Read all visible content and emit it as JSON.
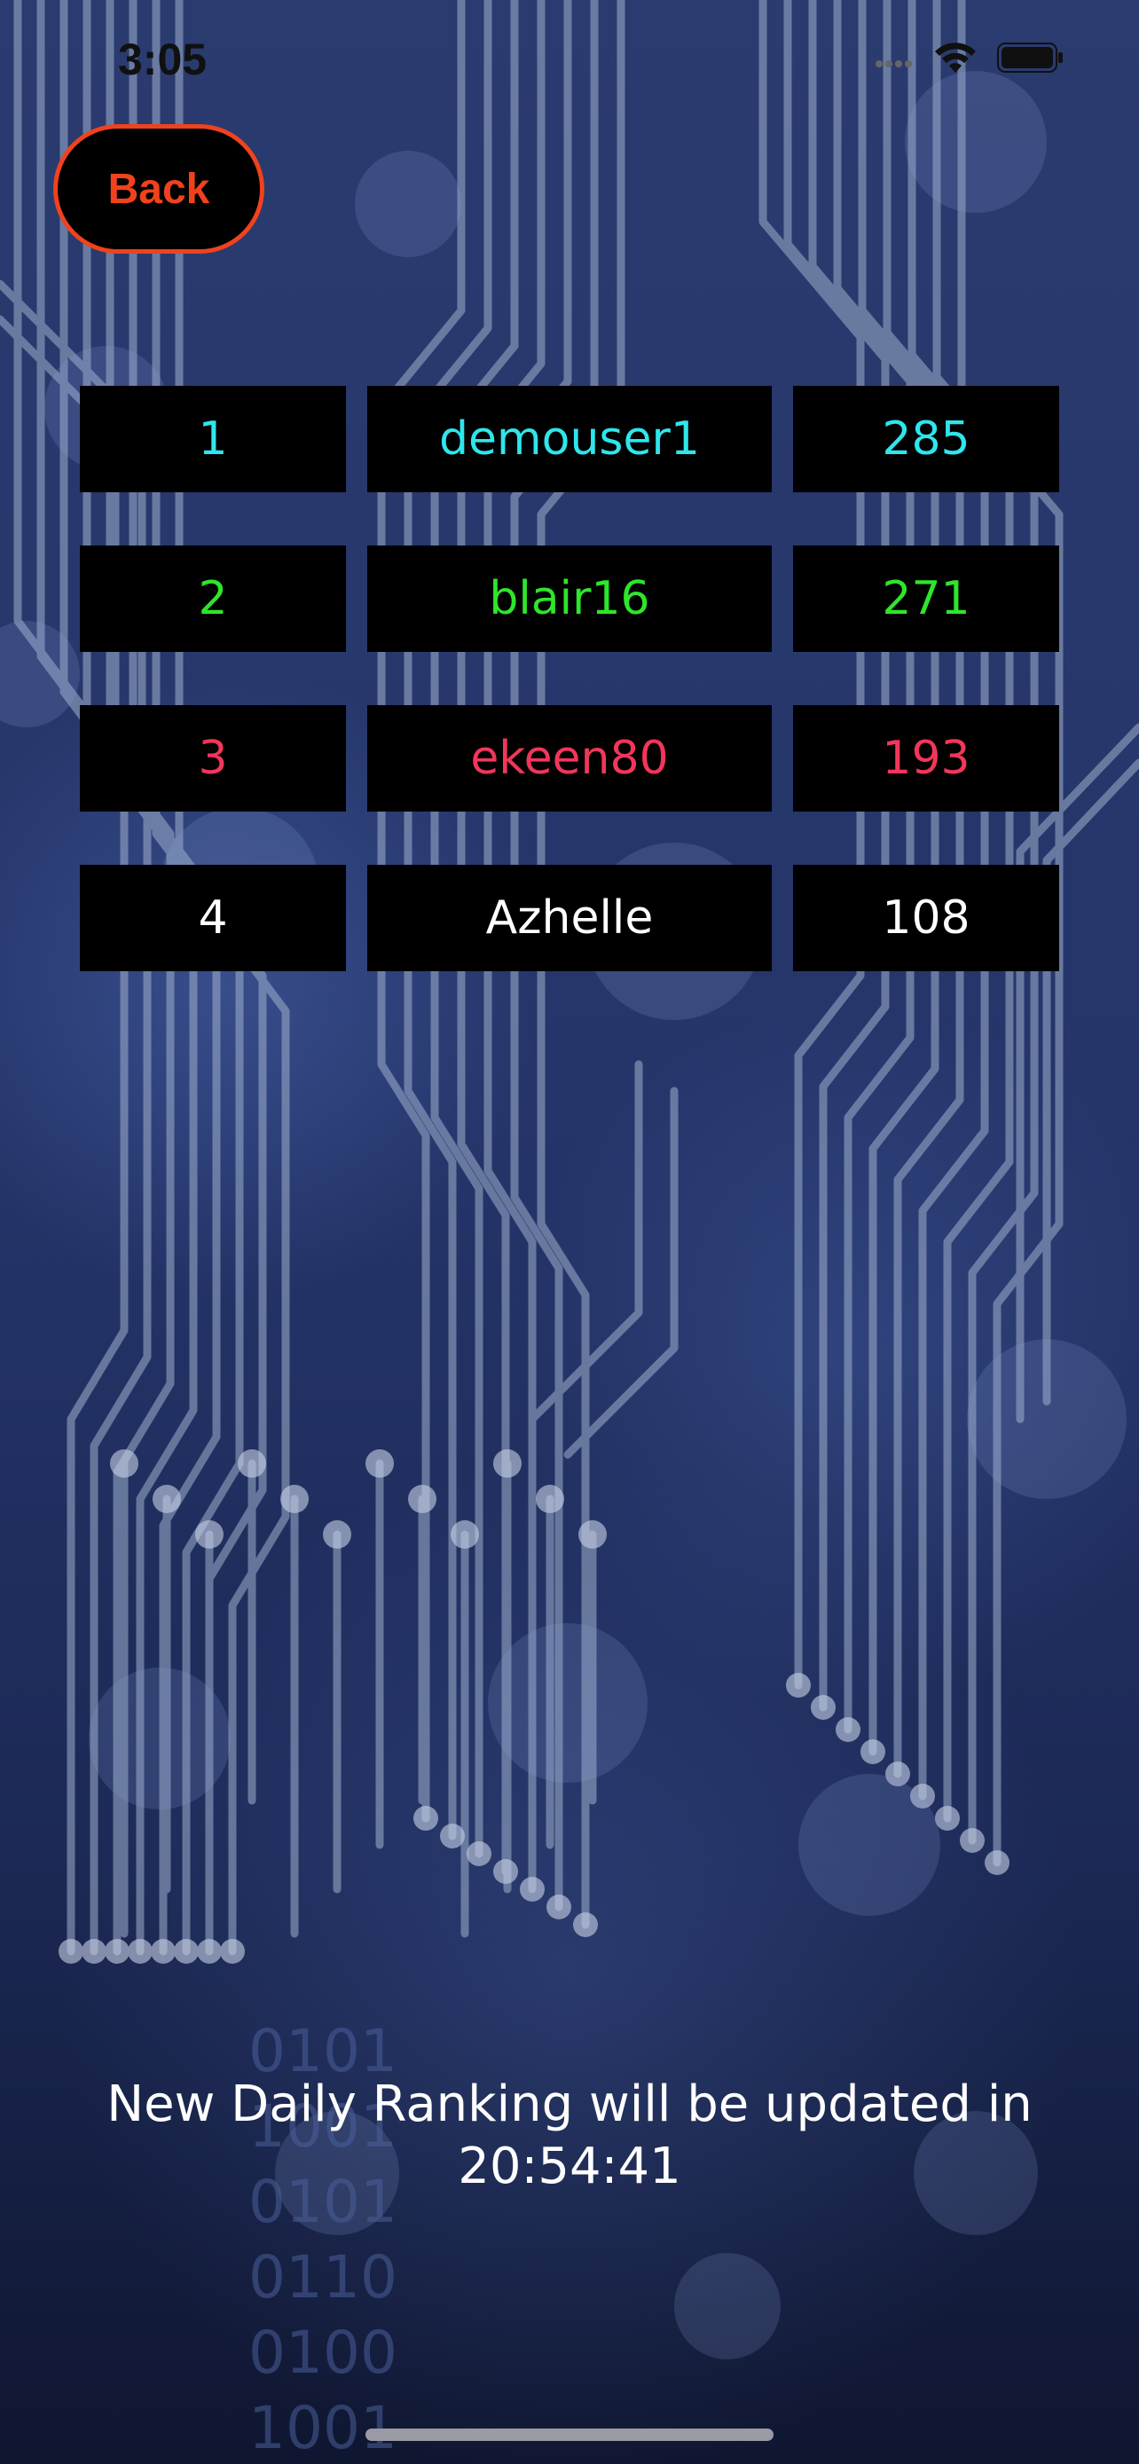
{
  "status_bar": {
    "time": "3:05",
    "icons": [
      "cellular-signal-icon",
      "wifi-icon",
      "battery-icon"
    ]
  },
  "back_button": {
    "label": "Back",
    "color": "#f0421c"
  },
  "leaderboard": {
    "rows": [
      {
        "rank": "1",
        "username": "demouser1",
        "score": "285",
        "color": "#2ee6ec"
      },
      {
        "rank": "2",
        "username": "blair16",
        "score": "271",
        "color": "#2ee62a"
      },
      {
        "rank": "3",
        "username": "ekeen80",
        "score": "193",
        "color": "#f2365a"
      },
      {
        "rank": "4",
        "username": "Azhelle",
        "score": "108",
        "color": "#ffffff"
      }
    ]
  },
  "footer": {
    "line1": "New Daily Ranking will be updated in",
    "countdown": "20:54:41"
  },
  "background": {
    "binary_digits": [
      "0101",
      "1001",
      "0101",
      "0110",
      "0100",
      "1001"
    ]
  }
}
